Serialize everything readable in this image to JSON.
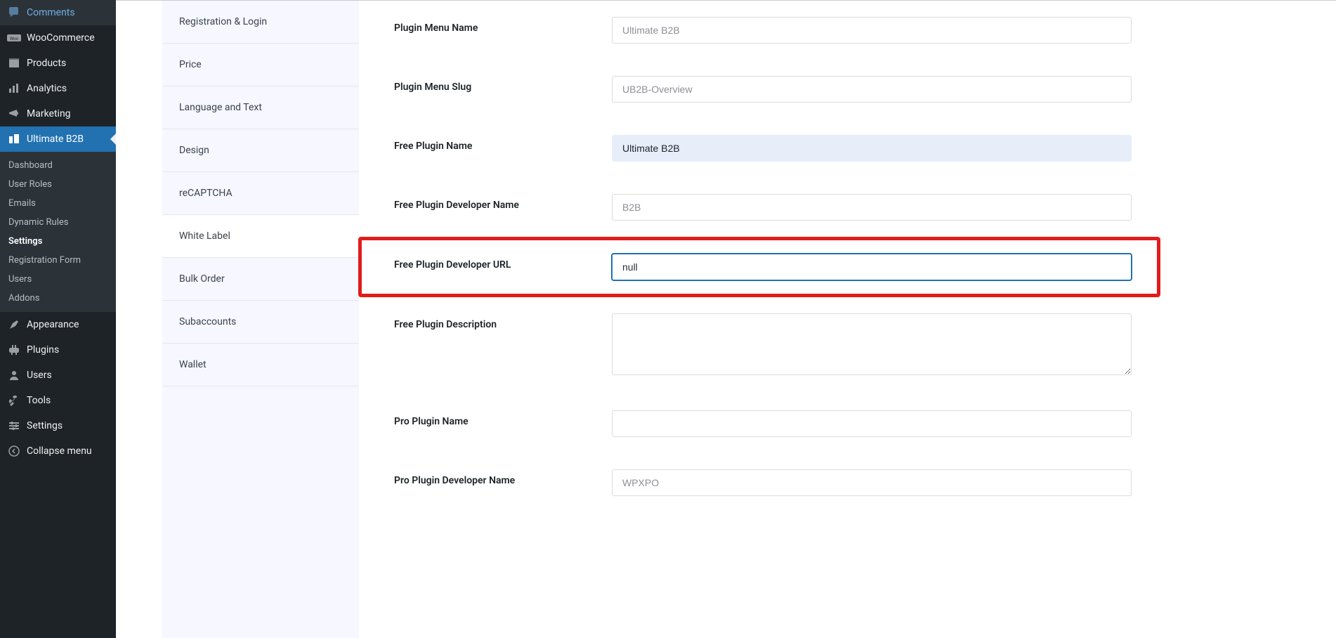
{
  "wpSidebar": {
    "comments": "Comments",
    "woocommerce": "WooCommerce",
    "products": "Products",
    "analytics": "Analytics",
    "marketing": "Marketing",
    "ultimateB2B": "Ultimate B2B",
    "submenu": {
      "dashboard": "Dashboard",
      "userRoles": "User Roles",
      "emails": "Emails",
      "dynamicRules": "Dynamic Rules",
      "settings": "Settings",
      "registrationForm": "Registration Form",
      "users": "Users",
      "addons": "Addons"
    },
    "appearance": "Appearance",
    "plugins": "Plugins",
    "users": "Users",
    "tools": "Tools",
    "settings": "Settings",
    "collapse": "Collapse menu"
  },
  "settingsTabs": {
    "registration": "Registration & Login",
    "price": "Price",
    "language": "Language and Text",
    "design": "Design",
    "recaptcha": "reCAPTCHA",
    "whiteLabel": "White Label",
    "bulkOrder": "Bulk Order",
    "subaccounts": "Subaccounts",
    "wallet": "Wallet"
  },
  "fields": {
    "pluginMenuName": {
      "label": "Plugin Menu Name",
      "placeholder": "Ultimate B2B",
      "value": ""
    },
    "pluginMenuSlug": {
      "label": "Plugin Menu Slug",
      "placeholder": "UB2B-Overview",
      "value": ""
    },
    "freePluginName": {
      "label": "Free Plugin Name",
      "placeholder": "",
      "value": "Ultimate B2B"
    },
    "freePluginDevName": {
      "label": "Free Plugin Developer Name",
      "placeholder": "B2B",
      "value": ""
    },
    "freePluginDevUrl": {
      "label": "Free Plugin Developer URL",
      "placeholder": "",
      "value": "null"
    },
    "freePluginDesc": {
      "label": "Free Plugin Description",
      "placeholder": "",
      "value": ""
    },
    "proPluginName": {
      "label": "Pro Plugin Name",
      "placeholder": "",
      "value": ""
    },
    "proPluginDevName": {
      "label": "Pro Plugin Developer Name",
      "placeholder": "WPXPO",
      "value": ""
    }
  }
}
